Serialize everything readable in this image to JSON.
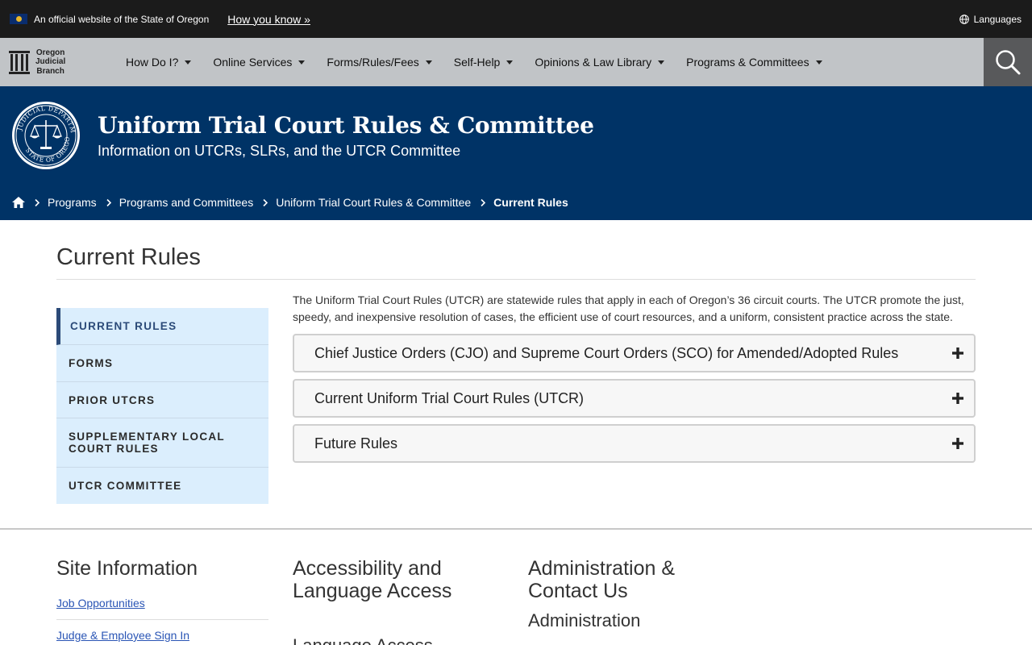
{
  "banner": {
    "official_text": "An official website of the State of Oregon",
    "how_you_know": "How you know »",
    "languages": "Languages"
  },
  "nav": {
    "logo_lines": [
      "Oregon",
      "Judicial",
      "Branch"
    ],
    "items": [
      {
        "label": "How Do I?"
      },
      {
        "label": "Online Services"
      },
      {
        "label": "Forms/Rules/Fees"
      },
      {
        "label": "Self-Help"
      },
      {
        "label": "Opinions & Law Library"
      },
      {
        "label": "Programs & Committees"
      }
    ]
  },
  "hero": {
    "title": "Uniform Trial Court Rules & Committee",
    "subtitle": "Information on UTCRs, SLRs, and the UTCR Committee"
  },
  "breadcrumb": {
    "items": [
      "Programs",
      "Programs and Committees",
      "Uniform Trial Court Rules & Committee"
    ],
    "current": "Current Rules"
  },
  "main": {
    "title": "Current Rules",
    "intro": "The Uniform Trial Court Rules (UTCR) are statewide rules that apply in each of Oregon’s 36 circuit courts. The UTCR promote the just, speedy, and inexpensive resolution of cases, the efficient use of court resources, and a uniform, consistent practice across the state.",
    "accordions": [
      {
        "label": "Chief Justice Orders (CJO) and Supreme Court Orders (SCO) for Amended/Adopted Rules"
      },
      {
        "label": "Current Uniform Trial Court Rules (UTCR)"
      },
      {
        "label": "Future Rules"
      }
    ]
  },
  "side_menu": {
    "items": [
      {
        "label": "Current Rules",
        "active": true
      },
      {
        "label": "Forms"
      },
      {
        "label": "Prior UTCRs"
      },
      {
        "label": "Supplementary Local Court Rules"
      },
      {
        "label": "UTCR Committee"
      }
    ]
  },
  "footer": {
    "site_info": {
      "heading": "Site Information",
      "links": [
        "Job Opportunities",
        "Judge & Employee Sign In"
      ]
    },
    "accessibility": {
      "heading": "Accessibility and Language Access",
      "sub": "Language Access"
    },
    "admin": {
      "heading": "Administration & Contact Us",
      "sub": "Administration"
    }
  },
  "colors": {
    "banner_bg": "#1b1b1b",
    "nav_bg": "#c1c4c7",
    "search_bg": "#58595b",
    "hero_bg": "#003366",
    "side_menu_bg": "#dbeefd",
    "link": "#2a55b5"
  }
}
